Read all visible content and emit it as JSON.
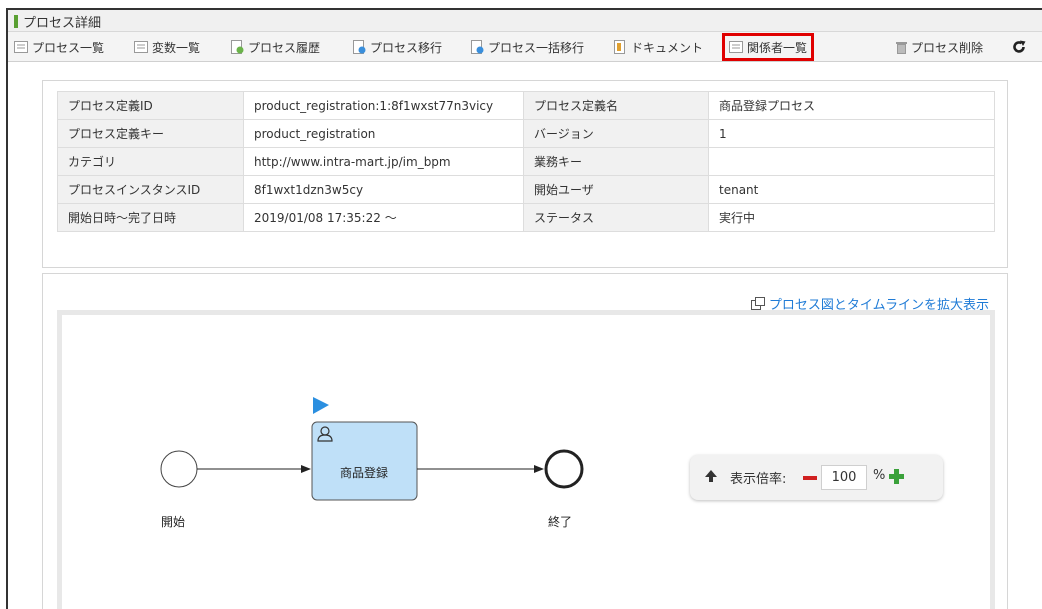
{
  "window": {
    "title": "プロセス詳細"
  },
  "toolbar": {
    "process_list": "プロセス一覧",
    "variable_list": "変数一覧",
    "process_history": "プロセス履歴",
    "process_migration": "プロセス移行",
    "process_bulk_migration": "プロセス一括移行",
    "document": "ドキュメント",
    "stakeholder_list": "関係者一覧",
    "process_delete": "プロセス削除"
  },
  "details": {
    "rows": [
      {
        "label1": "プロセス定義ID",
        "value1": "product_registration:1:8f1wxst77n3vicy",
        "label2": "プロセス定義名",
        "value2": "商品登録プロセス"
      },
      {
        "label1": "プロセス定義キー",
        "value1": "product_registration",
        "label2": "バージョン",
        "value2": "1"
      },
      {
        "label1": "カテゴリ",
        "value1": "http://www.intra-mart.jp/im_bpm",
        "label2": "業務キー",
        "value2": ""
      },
      {
        "label1": "プロセスインスタンスID",
        "value1": "8f1wxt1dzn3w5cy",
        "label2": "開始ユーザ",
        "value2": "tenant"
      },
      {
        "label1": "開始日時～完了日時",
        "value1": "2019/01/08 17:35:22 ～",
        "label2": "ステータス",
        "value2": "実行中"
      }
    ]
  },
  "diagram": {
    "expand_link": "プロセス図とタイムラインを拡大表示",
    "start_label": "開始",
    "task_label": "商品登録",
    "end_label": "終了"
  },
  "zoom": {
    "label": "表示倍率:",
    "value": "100",
    "unit": "%"
  },
  "colors": {
    "highlight": "#e00000",
    "link": "#1f7bd6",
    "task_fill": "#bfe0f8",
    "marker": "#2b8fe0",
    "plus": "#3aa13a",
    "minus": "#d02020"
  }
}
